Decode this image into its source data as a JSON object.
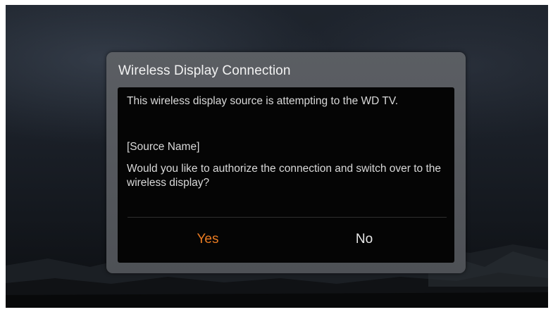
{
  "dialog": {
    "title": "Wireless Display Connection",
    "message_line1": "This wireless display source is attempting to the WD TV.",
    "source_name": "[Source Name]",
    "message_line2": "Would you like to authorize the connection and switch over to the wireless display?",
    "yes_label": "Yes",
    "no_label": "No"
  },
  "colors": {
    "selected_button": "#e97b22",
    "dialog_frame": "#56595e",
    "dialog_body": "#050505",
    "text": "#d9d9d9"
  }
}
